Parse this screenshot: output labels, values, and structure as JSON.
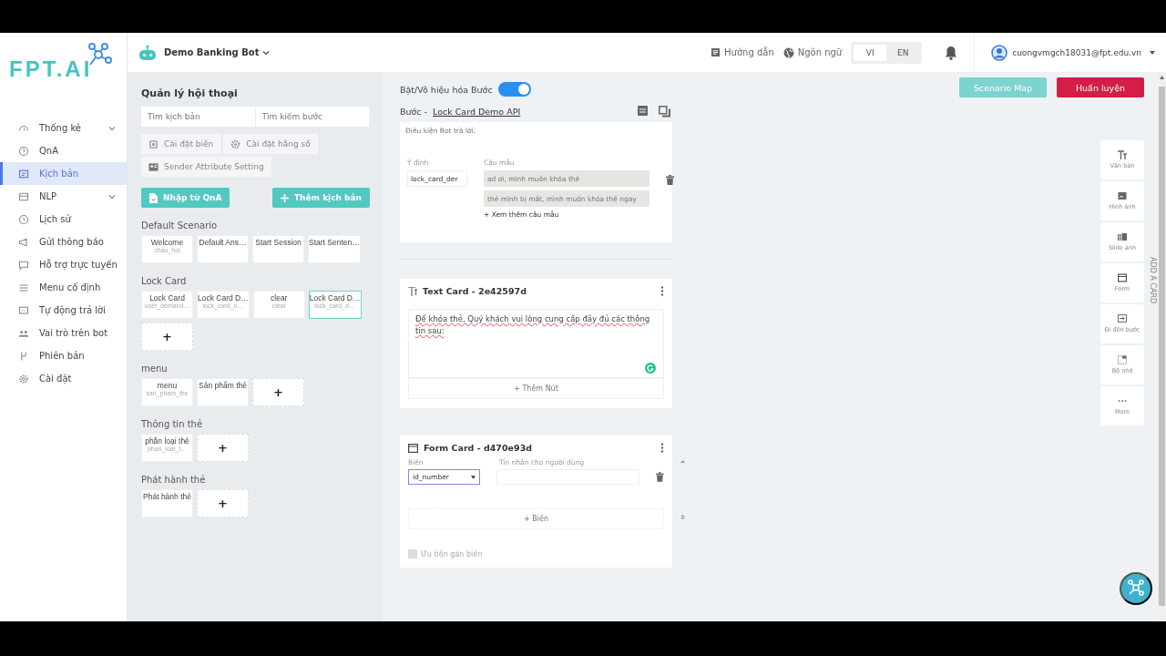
{
  "logo": {
    "text": "FPT.AI"
  },
  "sidebar": {
    "items": [
      {
        "label": "Thống kê",
        "selected": false,
        "expandable": true
      },
      {
        "label": "QnA",
        "selected": false,
        "expandable": false
      },
      {
        "label": "Kịch bản",
        "selected": true,
        "expandable": false
      },
      {
        "label": "NLP",
        "selected": false,
        "expandable": true
      },
      {
        "label": "Lịch sử",
        "selected": false,
        "expandable": false
      },
      {
        "label": "Gửi thông báo",
        "selected": false,
        "expandable": false
      },
      {
        "label": "Hỗ trợ trực tuyến",
        "selected": false,
        "expandable": false
      },
      {
        "label": "Menu cố định",
        "selected": false,
        "expandable": false
      },
      {
        "label": "Tự động trả lời",
        "selected": false,
        "expandable": false
      },
      {
        "label": "Vai trò trên bot",
        "selected": false,
        "expandable": false
      },
      {
        "label": "Phiên bản",
        "selected": false,
        "expandable": false
      },
      {
        "label": "Cài đặt",
        "selected": false,
        "expandable": false
      }
    ]
  },
  "header": {
    "bot_name": "Demo Banking Bot",
    "guide": "Hướng dẫn",
    "language_label": "Ngôn ngữ",
    "languages": [
      {
        "label": "VI",
        "selected": true
      },
      {
        "label": "EN",
        "selected": false
      }
    ],
    "user": "cuongvmgch18031@fpt.edu.vn"
  },
  "scenario_panel": {
    "title": "Quản lý hội thoại",
    "search_fields": [
      {
        "placeholder": "Tìm kịch bản"
      },
      {
        "placeholder": "Tìm kiếm bước"
      }
    ],
    "setting_buttons": [
      "Cài đặt biến",
      "Cài đặt hằng số",
      "Sender Attribute Setting"
    ],
    "import_button": "Nhập từ QnA",
    "add_button": "Thêm kịch bản",
    "groups": [
      {
        "name": "Default Scenario",
        "steps": [
          {
            "title": "Welcome",
            "intent": "chao_hoi",
            "selected": false
          },
          {
            "title": "Default Ans…",
            "selected": false
          },
          {
            "title": "Start Session",
            "selected": false
          },
          {
            "title": "Start Senten…",
            "selected": false
          }
        ]
      },
      {
        "name": "Lock Card",
        "add_label": "+",
        "steps": [
          {
            "title": "Lock Card",
            "intent": "user_demand…",
            "selected": false
          },
          {
            "title": "Lock Card D…",
            "intent": "lock_card_d…",
            "selected": false
          },
          {
            "title": "clear",
            "intent": "clear",
            "selected": false
          },
          {
            "title": "Lock Card D…",
            "intent": "lock_card_d…",
            "selected": true
          }
        ]
      },
      {
        "name": "menu",
        "add_label": "+",
        "steps": [
          {
            "title": "menu",
            "intent": "san_pham_the",
            "selected": false
          },
          {
            "title": "Sản phẩm thẻ",
            "selected": false
          }
        ]
      },
      {
        "name": "Thông tin thẻ",
        "add_label": "+",
        "steps": [
          {
            "title": "phần loại thẻ",
            "intent": "phan_loai_t…",
            "selected": false
          }
        ]
      },
      {
        "name": "Phát hành thẻ",
        "add_label": "+",
        "steps": [
          {
            "title": "Phát hành thẻ",
            "selected": false
          }
        ]
      }
    ]
  },
  "step_editor": {
    "toggle": {
      "label": "Bật/Vô hiệu hóa Bước",
      "on": true
    },
    "step_label": "Bước -",
    "step_name": "Lock Card Demo API",
    "condition": {
      "title": "Điều kiện Bot trả lời:",
      "intent_label": "Ý định",
      "intent_value": "lock_card_der",
      "samples_label": "Câu mẫu",
      "samples": [
        "ad ơi, mình muốn khóa thẻ",
        "thẻ mình bị mất, mình muốn khóa thẻ ngay"
      ],
      "more": "+ Xem thêm câu mẫu"
    },
    "cards": [
      {
        "kind": "text",
        "title": "Text Card - 2e42597d",
        "body": "Để khóa thẻ, Quý khách vui lòng cung cấp đầy đủ các thông tin sau:",
        "add_button": "+ Thêm Nút"
      },
      {
        "kind": "form",
        "title": "Form Card - d470e93d",
        "variable_label": "Biến",
        "message_label": "Tin nhắn cho người dùng",
        "variable_value": "id_number",
        "add_button": "+ Biến",
        "priority": {
          "label": "Ưu tiên gán biến",
          "checked": false
        }
      }
    ]
  },
  "action_buttons": [
    {
      "label": "Scenario Map",
      "kind": "secondary"
    },
    {
      "label": "Huấn luyện",
      "kind": "primary"
    }
  ],
  "add_card_panel": {
    "title": "ADD A CARD",
    "items": [
      "Văn bản",
      "Hình ảnh",
      "Slide ảnh",
      "Form",
      "Đi đến bước",
      "Bộ nhớ",
      "More"
    ]
  }
}
